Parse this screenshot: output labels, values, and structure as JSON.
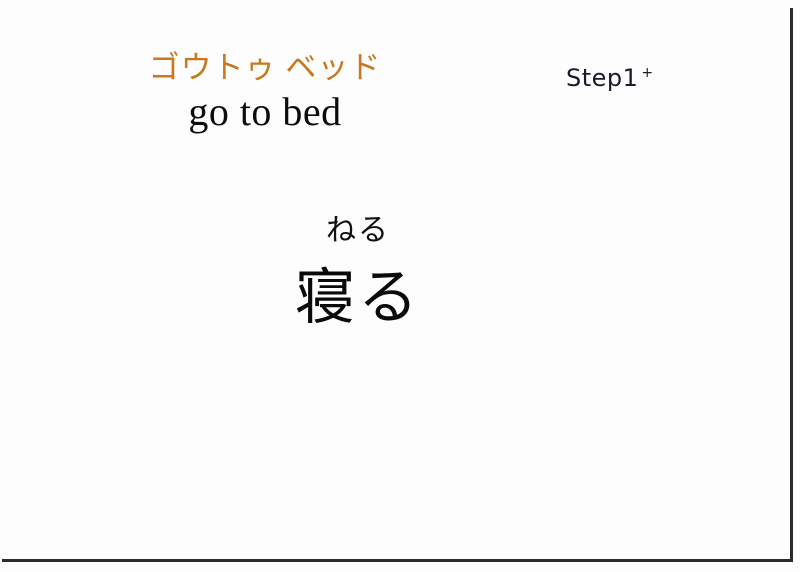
{
  "page": {
    "background_color": "#fdfdfd",
    "border_color": "#2b2b2f"
  },
  "phrase": {
    "katakana": "ゴウトゥ ベッド",
    "katakana_color": "#c8781f",
    "english": "go to bed"
  },
  "step": {
    "label": "Step1",
    "superscript": "+"
  },
  "vocabulary": {
    "furigana": "ねる",
    "kanji": "寝る"
  }
}
